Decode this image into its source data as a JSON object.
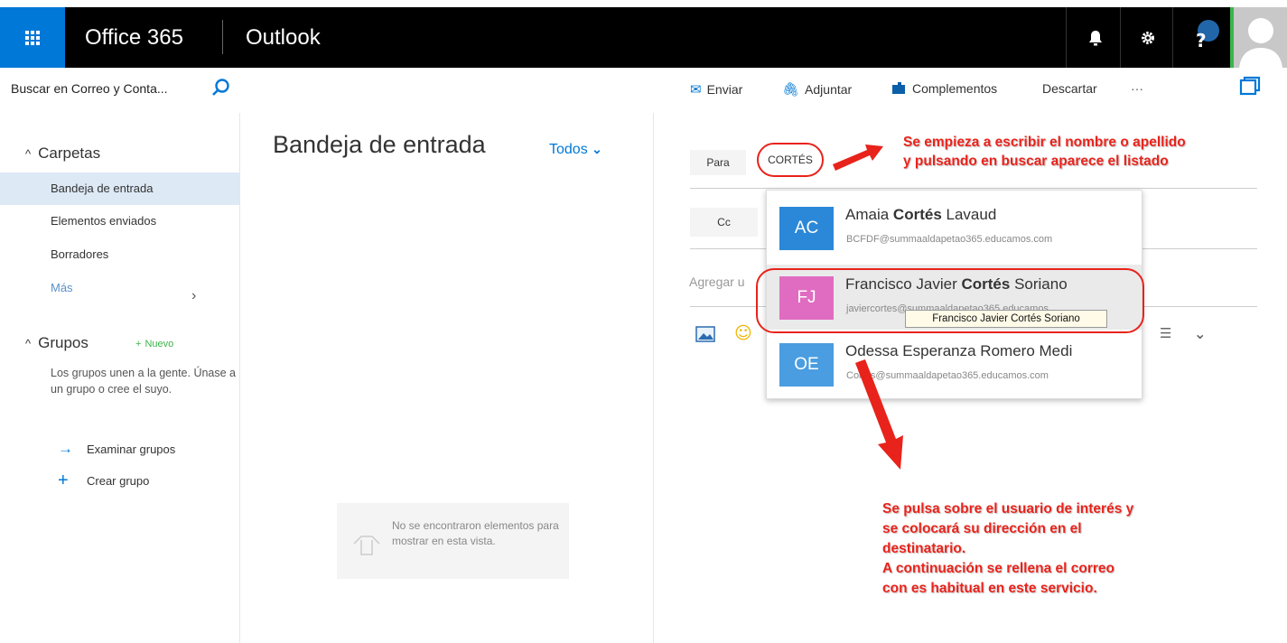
{
  "topbar": {
    "brand": "Office 365",
    "app": "Outlook",
    "icons": [
      "bell-icon",
      "gear-icon",
      "help-icon",
      "avatar"
    ],
    "waffle_color": "#0078d7"
  },
  "search": {
    "placeholder": "Buscar en Correo y Conta..."
  },
  "commands": {
    "send": "Enviar",
    "attach": "Adjuntar",
    "addins": "Complementos",
    "discard": "Descartar",
    "more": "···"
  },
  "nav": {
    "folders_header": "Carpetas",
    "items": [
      {
        "label": "Bandeja de entrada",
        "selected": true
      },
      {
        "label": "Elementos enviados"
      },
      {
        "label": "Borradores"
      },
      {
        "label": "Más"
      }
    ],
    "groups_header": "Grupos",
    "groups_new": "Nuevo",
    "groups_text": "Los grupos unen a la gente. Únase a un grupo o cree el suyo.",
    "explore": "Examinar grupos",
    "create": "Crear grupo"
  },
  "inbox": {
    "title": "Bandeja de entrada",
    "filter": "Todos",
    "empty_text": "No se encontraron elementos para mostrar en esta vista."
  },
  "compose": {
    "to_label": "Para",
    "cc_label": "Cc",
    "to_value": "CORTÉS",
    "subject_placeholder": "Agregar u"
  },
  "suggestions": [
    {
      "initials": "AC",
      "name_pre": "Amaia ",
      "name_bold": "Cortés",
      "name_post": " Lavaud",
      "email": "BCFDF@summaaldapetao365.educamos.com",
      "color": "#2b88d8"
    },
    {
      "initials": "FJ",
      "name_pre": "Francisco Javier ",
      "name_bold": "Cortés",
      "name_post": " Soriano",
      "email": "javiercortes@summaaldapetao365.educamos",
      "color": "#e06cc1"
    },
    {
      "initials": "OE",
      "name_pre": "Odessa Esperanza Romero Medi",
      "name_bold": "",
      "name_post": "",
      "email": "Cortes@summaaldapetao365.educamos.com",
      "color": "#4a9de0"
    }
  ],
  "tooltip": "Francisco Javier Cortés Soriano",
  "annotations": {
    "top_line1": "Se empieza a escribir el nombre o apellido",
    "top_line2": "y pulsando en buscar aparece el listado",
    "bottom_line1": "Se pulsa sobre el usuario de interés y",
    "bottom_line2": "se colocará su dirección en el",
    "bottom_line3": "destinatario.",
    "bottom_line4": "A continuación se rellena el correo",
    "bottom_line5": "con es habitual en  este servicio.",
    "color": "#e8231b"
  }
}
